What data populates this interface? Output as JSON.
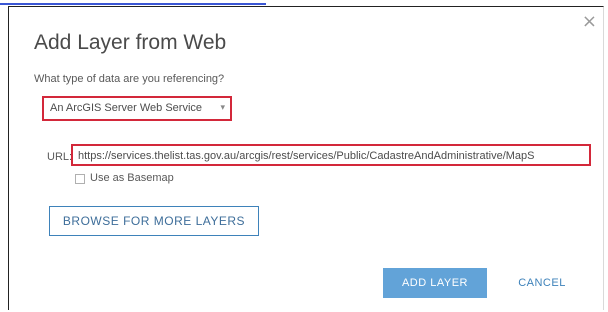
{
  "dialog": {
    "title": "Add Layer from Web",
    "close_icon": "close-icon",
    "question": "What type of data are you referencing?",
    "data_type_select": {
      "value": "An ArcGIS Server Web Service"
    },
    "url": {
      "label": "URL:",
      "value": "https://services.thelist.tas.gov.au/arcgis/rest/services/Public/CadastreAndAdministrative/MapS"
    },
    "basemap_checkbox": {
      "label": "Use as Basemap",
      "checked": false
    },
    "browse_button": "BROWSE FOR MORE LAYERS",
    "add_button": "ADD LAYER",
    "cancel_button": "CANCEL"
  },
  "colors": {
    "highlight_border": "#d3283a",
    "primary_button": "#62a3d8",
    "link_blue": "#3e82ba"
  }
}
